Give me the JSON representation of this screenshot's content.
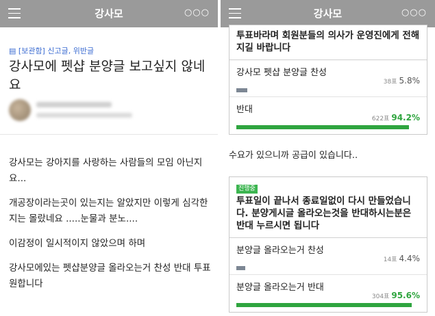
{
  "app": {
    "title": "강사모"
  },
  "left": {
    "category": "[보관함] 신고글, 위반글",
    "post_title": "강사모에 펫샵 분양글 보고싶지 않네요",
    "paragraphs": [
      "강사모는 강아지를 사랑하는 사람들의 모임 아닌지요...",
      "개공장이라는곳이 있는지는 알았지만 이렇게 심각한지는 몰랐네요 .....눈물과 분노....",
      "이감정이 일시적이지 않았으며 하며",
      "강사모에있는 펫샵분양글 올라오는거 찬성 반대 투표원합니다"
    ]
  },
  "right": {
    "poll1": {
      "question": "투표바라며 회원분들의 의사가 운영진에게 전해지길 바랍니다",
      "options": [
        {
          "label": "강사모 펫샵 분양글 찬성",
          "votes": "38표",
          "percent": "5.8%",
          "fraction": 0.058
        },
        {
          "label": "반대",
          "votes": "622표",
          "percent": "94.2%",
          "fraction": 0.942
        }
      ]
    },
    "middle_text": "수요가 있으니까 공급이 있습니다..",
    "poll2": {
      "badge": "진행중",
      "question": "투표일이 끝나서 종료일없이 다시 만들었습니다. 분양게시글 올라오는것을 반대하시는분은 반대 누르시면 됩니다",
      "options": [
        {
          "label": "분양글 올라오는거 찬성",
          "votes": "14표",
          "percent": "4.4%",
          "fraction": 0.044
        },
        {
          "label": "분양글 올라오는거 반대",
          "votes": "304표",
          "percent": "95.6%",
          "fraction": 0.956
        }
      ]
    }
  },
  "colors": {
    "header": "#9a9a9a",
    "accent_blue": "#3a6bd1",
    "win_green": "#2fa53f",
    "bar_gray": "#7d8794"
  },
  "icons": {
    "menu": "hamburger-icon",
    "more": "more-dots-icon"
  }
}
